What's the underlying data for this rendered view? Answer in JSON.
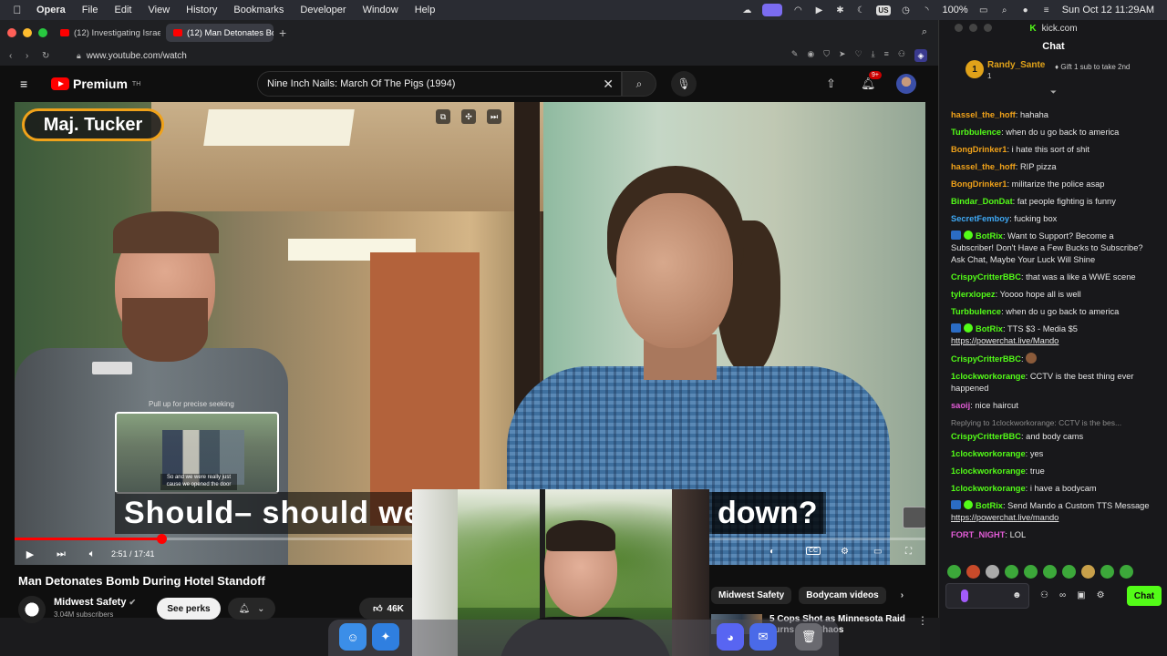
{
  "menubar": {
    "app": "Opera",
    "items": [
      "File",
      "Edit",
      "View",
      "History",
      "Bookmarks",
      "Developer",
      "Window",
      "Help"
    ],
    "battery": "100%",
    "datetime": "Sun Oct 12  11:29AM",
    "input_badge": "US"
  },
  "browser": {
    "tabs": [
      {
        "label": "(12) Investigating Israeli"
      },
      {
        "label": "(12) Man Detonates Bom"
      }
    ],
    "url": "www.youtube.com/watch"
  },
  "youtube": {
    "logo": "Premium",
    "logo_sup": "TH",
    "search_value": "Nine Inch Nails: March Of The Pigs (1994)",
    "notif_count": "9+",
    "video": {
      "overlay_label": "Maj. Tucker",
      "preview_hint": "Pull up for precise seeking",
      "preview_caption": "So and we were really just cause we opened the door",
      "subtitle_left": "Should– should we b",
      "subtitle_right": "down?",
      "time": "2:51 / 17:41",
      "progress_fraction": 0.161,
      "cc_label": "CC"
    },
    "title": "Man Detonates Bomb During Hotel Standoff",
    "channel": {
      "name": "Midwest Safety",
      "subscribers": "3.04M subscribers",
      "perks_label": "See perks",
      "likes": "46K"
    },
    "chips": [
      "Midwest Safety",
      "Bodycam videos"
    ],
    "recommended": {
      "title": "5 Cops Shot as Minnesota Raid Turns Into Chaos"
    }
  },
  "chat": {
    "site": "kick.com",
    "title": "Chat",
    "pinned": {
      "user": "Randy_Sante",
      "count": "1",
      "gift_text": "Gift 1 sub to take 2nd"
    },
    "messages": [
      {
        "user": "hassel_the_hoff",
        "color": "#f0a21a",
        "text": "hahaha"
      },
      {
        "user": "Turbbulence",
        "color": "#53fc18",
        "text": "when do u go back to america"
      },
      {
        "user": "BongDrinker1",
        "color": "#f0a21a",
        "text": "i hate this sort of shit"
      },
      {
        "user": "hassel_the_hoff",
        "color": "#f0a21a",
        "text": "RIP pizza"
      },
      {
        "user": "BongDrinker1",
        "color": "#f0a21a",
        "text": "militarize the police asap"
      },
      {
        "user": "Bindar_DonDat",
        "color": "#53fc18",
        "text": "fat people fighting is funny"
      },
      {
        "user": "SecretFemboy",
        "color": "#3fa9f5",
        "text": "fucking box"
      },
      {
        "user": "BotRix",
        "color": "#53fc18",
        "bot": true,
        "text": "Want to Support? Become a Subscriber! Don't Have a Few Bucks to Subscribe? Ask Chat, Maybe Your Luck Will Shine"
      },
      {
        "user": "CrispyCritterBBC",
        "color": "#53fc18",
        "text": "that was a like a WWE scene"
      },
      {
        "user": "tylerxlopez",
        "color": "#53fc18",
        "text": "Yoooo hope all is well"
      },
      {
        "user": "Turbbulence",
        "color": "#53fc18",
        "text": "when do u go back to america"
      },
      {
        "user": "BotRix",
        "color": "#53fc18",
        "bot": true,
        "text": "TTS $3 - Media $5",
        "link": "https://powerchat.live/Mando"
      },
      {
        "user": "CrispyCritterBBC",
        "color": "#53fc18",
        "text": "",
        "emote": true
      },
      {
        "user": "1clockworkorange",
        "color": "#53fc18",
        "text": "CCTV is the best thing ever happened"
      },
      {
        "user": "saoij",
        "color": "#e45cd8",
        "text": "nice haircut"
      },
      {
        "reply": "Replying to 1clockworkorange: CCTV is the bes..."
      },
      {
        "user": "CrispyCritterBBC",
        "color": "#53fc18",
        "text": "and body cams"
      },
      {
        "user": "1clockworkorange",
        "color": "#53fc18",
        "text": "yes"
      },
      {
        "user": "1clockworkorange",
        "color": "#53fc18",
        "text": "true"
      },
      {
        "user": "1clockworkorange",
        "color": "#53fc18",
        "text": "i have a bodycam"
      },
      {
        "user": "BotRix",
        "color": "#53fc18",
        "bot": true,
        "text": "Send Mando a Custom TTS Message",
        "link": "https://powerchat.live/mando"
      },
      {
        "user": "FORT_NIGHT",
        "color": "#e45cd8",
        "text": "LOL"
      }
    ],
    "send_label": "Chat"
  }
}
